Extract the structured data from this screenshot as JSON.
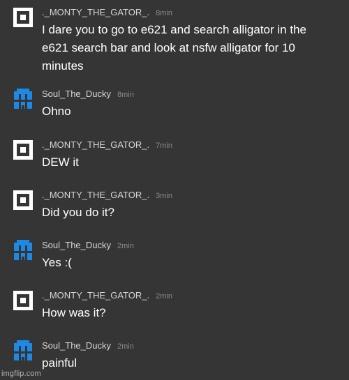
{
  "messages": [
    {
      "avatar": "square-logo-icon",
      "username": "._MONTY_THE_GATOR_.",
      "time": "8min",
      "text": "I dare you to go to e621 and search alligator in the e621 search bar and look at nsfw alligator for 10 minutes"
    },
    {
      "avatar": "pixel-ghost-icon",
      "username": "Soul_The_Ducky",
      "time": "8min",
      "text": "Ohno"
    },
    {
      "avatar": "square-logo-icon",
      "username": "._MONTY_THE_GATOR_.",
      "time": "7min",
      "text": "DEW it"
    },
    {
      "avatar": "square-logo-icon",
      "username": "._MONTY_THE_GATOR_.",
      "time": "3min",
      "text": "Did you do it?"
    },
    {
      "avatar": "pixel-ghost-icon",
      "username": "Soul_The_Ducky",
      "time": "2min",
      "text": "Yes :("
    },
    {
      "avatar": "square-logo-icon",
      "username": "._MONTY_THE_GATOR_.",
      "time": "2min",
      "text": "How was it?"
    },
    {
      "avatar": "pixel-ghost-icon",
      "username": "Soul_The_Ducky",
      "time": "2min",
      "text": "painful"
    }
  ],
  "watermark": "imgflip.com",
  "colors": {
    "background": "#353535",
    "username": "#d6d6d6",
    "timestamp": "#8a8a8a",
    "message_text": "#ffffff",
    "square_avatar": "#ffffff",
    "ghost_avatar": "#1e88e5"
  }
}
